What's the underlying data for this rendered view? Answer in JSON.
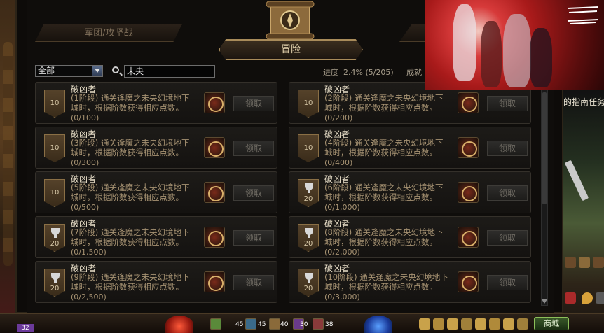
{
  "header": {
    "tab_left": "军团/攻坚战",
    "tab_main": "冒险"
  },
  "filter": {
    "category": "全部",
    "search_value": "未央",
    "progress_label": "进度",
    "progress_value": "2.4% (5/205)",
    "achieve_label": "成就"
  },
  "side": {
    "guide_text": "的指南任务"
  },
  "hud": {
    "level": "32",
    "shop_label": "商城",
    "counts": [
      "45",
      "45",
      "40",
      "30",
      "38"
    ]
  },
  "cards": [
    {
      "title": "破凶者",
      "desc": "(1阶段) 通关逢魔之未央幻境地下城时，根据阶数获得相应点数。",
      "progress": "(0/100)",
      "points": "10",
      "trophy": false,
      "claim": "领取"
    },
    {
      "title": "破凶者",
      "desc": "(2阶段) 通关逢魔之未央幻境地下城时，根据阶数获得相应点数。",
      "progress": "(0/200)",
      "points": "10",
      "trophy": false,
      "claim": "领取"
    },
    {
      "title": "破凶者",
      "desc": "(3阶段) 通关逢魔之未央幻境地下城时，根据阶数获得相应点数。",
      "progress": "(0/300)",
      "points": "10",
      "trophy": false,
      "claim": "领取"
    },
    {
      "title": "破凶者",
      "desc": "(4阶段) 通关逢魔之未央幻境地下城时，根据阶数获得相应点数。",
      "progress": "(0/400)",
      "points": "10",
      "trophy": false,
      "claim": "领取"
    },
    {
      "title": "破凶者",
      "desc": "(5阶段) 通关逢魔之未央幻境地下城时，根据阶数获得相应点数。",
      "progress": "(0/500)",
      "points": "10",
      "trophy": false,
      "claim": "领取"
    },
    {
      "title": "破凶者",
      "desc": "(6阶段) 通关逢魔之未央幻境地下城时，根据阶数获得相应点数。",
      "progress": "(0/1,000)",
      "points": "20",
      "trophy": true,
      "claim": "领取"
    },
    {
      "title": "破凶者",
      "desc": "(7阶段) 通关逢魔之未央幻境地下城时，根据阶数获得相应点数。",
      "progress": "(0/1,500)",
      "points": "20",
      "trophy": true,
      "claim": "领取"
    },
    {
      "title": "破凶者",
      "desc": "(8阶段) 通关逢魔之未央幻境地下城时，根据阶数获得相应点数。",
      "progress": "(0/2,000)",
      "points": "20",
      "trophy": true,
      "claim": "领取"
    },
    {
      "title": "破凶者",
      "desc": "(9阶段) 通关逢魔之未央幻境地下城时，根据阶数获得相应点数。",
      "progress": "(0/2,500)",
      "points": "20",
      "trophy": true,
      "claim": "领取"
    },
    {
      "title": "破凶者",
      "desc": "(10阶段) 通关逢魔之未央幻境地下城时，根据阶数获得相应点数。",
      "progress": "(0/3,000)",
      "points": "20",
      "trophy": true,
      "claim": "领取"
    }
  ]
}
